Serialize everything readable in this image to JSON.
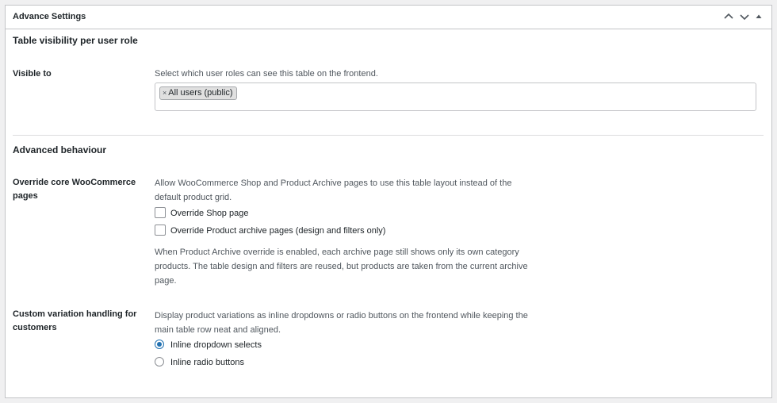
{
  "panel": {
    "title": "Advance Settings",
    "controls": [
      "chevron-up",
      "chevron-down",
      "triangle-up"
    ]
  },
  "visibility": {
    "section_title": "Table visibility per user role",
    "label": "Visible to",
    "description": "Select which user roles can see this table on the frontend.",
    "selected_tag": "All users (public)",
    "tag_remove": "×"
  },
  "advanced": {
    "section_title": "Advanced behaviour",
    "override": {
      "label": "Override core WooCommerce pages",
      "description": "Allow WooCommerce Shop and Product Archive pages to use this table layout instead of the default product grid.",
      "options": [
        {
          "label": "Override Shop page",
          "checked": false
        },
        {
          "label": "Override Product archive pages (design and filters only)",
          "checked": false
        }
      ],
      "note": "When Product Archive override is enabled, each archive page still shows only its own category products. The table design and filters are reused, but products are taken from the current archive page."
    },
    "variation": {
      "label": "Custom variation handling for customers",
      "description": "Display product variations as inline dropdowns or radio buttons on the frontend while keeping the main table row neat and aligned.",
      "options": [
        {
          "label": "Inline dropdown selects",
          "selected": true
        },
        {
          "label": "Inline radio buttons",
          "selected": false
        }
      ]
    }
  },
  "colors": {
    "accent": "#2271b1",
    "border": "#c3c4c7",
    "background": "#f0f0f1"
  }
}
